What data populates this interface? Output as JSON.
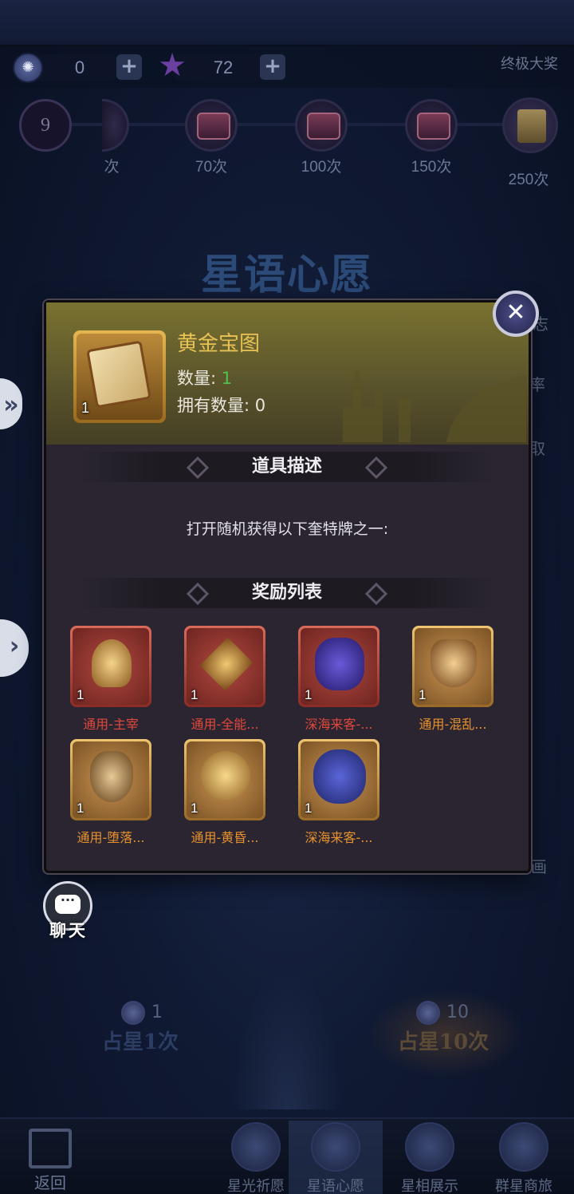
{
  "resources": {
    "moon_coin": "0",
    "star": "72",
    "top_right_label": "终极大奖"
  },
  "milestones": {
    "count_badge": "9",
    "items": [
      {
        "label": "次"
      },
      {
        "label": "70次"
      },
      {
        "label": "100次"
      },
      {
        "label": "150次"
      },
      {
        "label": "250次"
      }
    ]
  },
  "page_title": "星语心愿",
  "right_side": {
    "label_1": "志",
    "label_2": "率",
    "label_3": "取",
    "label_4": "动画"
  },
  "modal": {
    "item_name": "黄金宝图",
    "item_qty_badge": "1",
    "quantity_label": "数量:",
    "quantity_value": "1",
    "owned_label": "拥有数量:",
    "owned_value": "0",
    "section_desc_title": "道具描述",
    "description": "打开随机获得以下奎特牌之一:",
    "section_rewards_title": "奖励列表",
    "rewards": [
      {
        "name": "通用-主宰",
        "qty": "1",
        "rarity": "red"
      },
      {
        "name": "通用-全能...",
        "qty": "1",
        "rarity": "red"
      },
      {
        "name": "深海来客-...",
        "qty": "1",
        "rarity": "red"
      },
      {
        "name": "通用-混乱...",
        "qty": "1",
        "rarity": "gold"
      },
      {
        "name": "通用-堕落...",
        "qty": "1",
        "rarity": "gold"
      },
      {
        "name": "通用-黄昏...",
        "qty": "1",
        "rarity": "gold"
      },
      {
        "name": "深海来客-...",
        "qty": "1",
        "rarity": "gold"
      }
    ]
  },
  "chat": {
    "label": "聊天",
    "icon_text": "···"
  },
  "draw": {
    "single": {
      "cost": "1",
      "label": "占星1次"
    },
    "ten": {
      "cost": "10",
      "label": "占星10次"
    }
  },
  "nav": {
    "back": "返回",
    "items": [
      {
        "label": "星光祈愿"
      },
      {
        "label": "星语心愿"
      },
      {
        "label": "星相展示"
      },
      {
        "label": "群星商旅"
      }
    ]
  }
}
